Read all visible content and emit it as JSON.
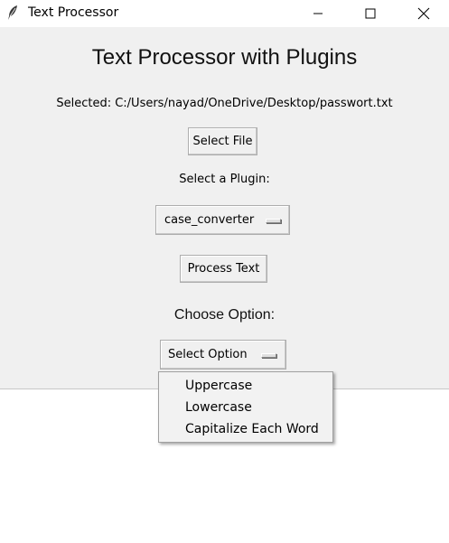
{
  "window": {
    "title": "Text Processor",
    "icon": "feather-icon"
  },
  "app": {
    "heading": "Text Processor with Plugins",
    "selected_file": "Selected: C:/Users/nayad/OneDrive/Desktop/passwort.txt",
    "select_file_label": "Select File",
    "plugin_label": "Select a Plugin:",
    "plugin_selected": "case_converter",
    "process_label": "Process Text",
    "option_label": "Choose Option:",
    "option_selected": "Select Option"
  },
  "option_menu": {
    "items": [
      "Uppercase",
      "Lowercase",
      "Capitalize Each Word"
    ]
  }
}
